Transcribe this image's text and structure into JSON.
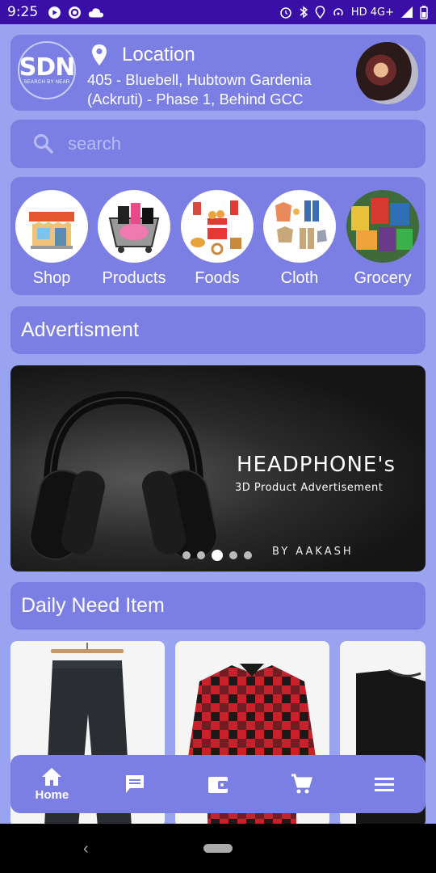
{
  "status_bar": {
    "time": "9:25",
    "network": "HD 4G+",
    "icons": [
      "media-icon",
      "sync-icon",
      "cloud-icon",
      "alarm-icon",
      "bluetooth-icon",
      "location-icon",
      "hotspot-icon",
      "signal-icon",
      "battery-icon"
    ]
  },
  "header": {
    "logo_big": "SDN",
    "logo_small": "SEARCH BY NEAR",
    "location_title": "Location",
    "address_line1": "405 - Bluebell, Hubtown Gardenia",
    "address_line2": "(Ackruti) - Phase 1, Behind GCC"
  },
  "search": {
    "placeholder": "search"
  },
  "categories": [
    {
      "label": "Shop"
    },
    {
      "label": "Products"
    },
    {
      "label": "Foods"
    },
    {
      "label": "Cloth"
    },
    {
      "label": "Grocery"
    }
  ],
  "advertisement": {
    "title": "Advertisment",
    "banner_title": "HEADPHONE's",
    "banner_subtitle": "3D Product Advertisement",
    "banner_by": "BY AAKASH",
    "slide_count": 5,
    "active_slide": 3
  },
  "daily": {
    "title": "Daily Need Item"
  },
  "bottom_nav": {
    "home_label": "Home",
    "icons": [
      "home-icon",
      "chat-icon",
      "wallet-icon",
      "cart-icon",
      "menu-icon"
    ]
  },
  "colors": {
    "status_bar": "#3a0fa8",
    "background": "#9aa3f0",
    "card": "#7b7fe3",
    "text": "#ffffff"
  }
}
